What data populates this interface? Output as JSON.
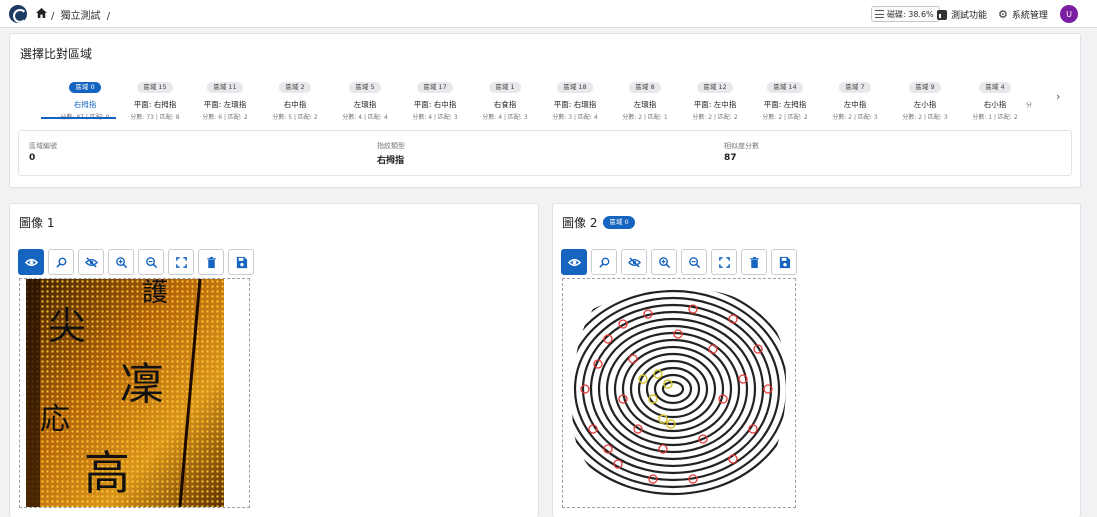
{
  "header": {
    "breadcrumb_sep": "/",
    "breadcrumb": [
      "獨立測試",
      "/"
    ],
    "memory_label": "磁碟: 38.6%",
    "nav_test": "測試功能",
    "nav_admin": "系統管理",
    "avatar_initial": "U",
    "accent": "#1565c0"
  },
  "region_panel": {
    "title": "選擇比對區域",
    "tabs": [
      {
        "chip": "區域 0",
        "name": "右拇指",
        "meta": "分數: 87 | 匹配: 9",
        "active": true
      },
      {
        "chip": "區域 15",
        "name": "平面: 右拇指",
        "meta": "分數: 73 | 匹配: 8"
      },
      {
        "chip": "區域 11",
        "name": "平面: 左環指",
        "meta": "分數: 6 | 匹配: 2"
      },
      {
        "chip": "區域 2",
        "name": "右中指",
        "meta": "分數: 5 | 匹配: 2"
      },
      {
        "chip": "區域 5",
        "name": "左環指",
        "meta": "分數: 4 | 匹配: 4"
      },
      {
        "chip": "區域 17",
        "name": "平面: 右中指",
        "meta": "分數: 4 | 匹配: 3"
      },
      {
        "chip": "區域 1",
        "name": "右食指",
        "meta": "分數: 4 | 匹配: 3"
      },
      {
        "chip": "區域 18",
        "name": "平面: 右環指",
        "meta": "分數: 3 | 匹配: 4"
      },
      {
        "chip": "區域 8",
        "name": "左環指",
        "meta": "分數: 2 | 匹配: 1"
      },
      {
        "chip": "區域 12",
        "name": "平面: 左中指",
        "meta": "分數: 2 | 匹配: 2"
      },
      {
        "chip": "區域 14",
        "name": "平面: 左拇指",
        "meta": "分數: 2 | 匹配: 2"
      },
      {
        "chip": "區域 7",
        "name": "左中指",
        "meta": "分數: 2 | 匹配: 3"
      },
      {
        "chip": "區域 9",
        "name": "左小指",
        "meta": "分數: 2 | 匹配: 3"
      },
      {
        "chip": "區域 4",
        "name": "右小指",
        "meta": "分數: 1 | 匹配: 2"
      }
    ],
    "overflow_text": "分",
    "info": {
      "region_no_label": "區域編號",
      "region_no": "0",
      "finger_type_label": "指紋類型",
      "finger_type": "右拇指",
      "score_label": "相似度分數",
      "score": "87"
    }
  },
  "image1": {
    "title": "圖像 1"
  },
  "image2": {
    "title": "圖像 2",
    "badge": "區域 0"
  },
  "toolbar_icons": [
    "eye-icon",
    "search-icon",
    "eye-off-icon",
    "zoom-in-icon",
    "zoom-out-icon",
    "fit-screen-icon",
    "delete-icon",
    "save-icon"
  ]
}
